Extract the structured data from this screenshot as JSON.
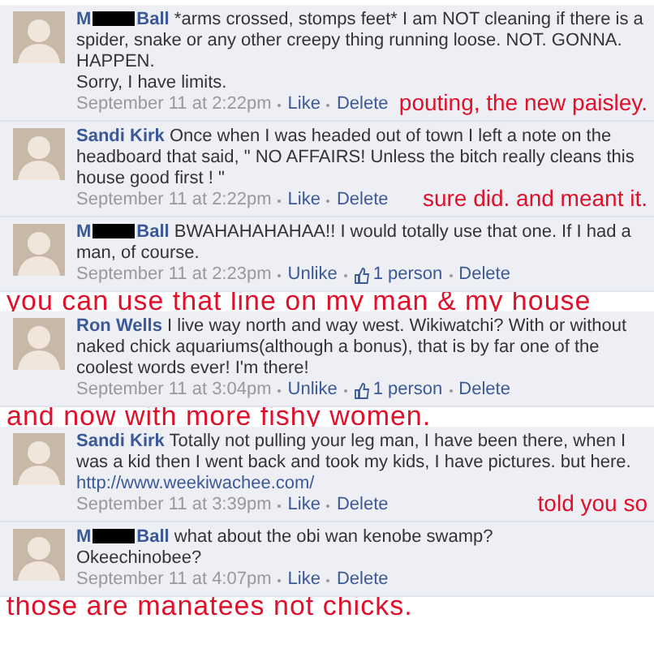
{
  "comments": [
    {
      "author": {
        "name_start": "M",
        "name_end": "Ball",
        "redacted": true
      },
      "text": "*arms crossed, stomps feet* I am NOT cleaning if there is a spider, snake or any other creepy thing running loose. NOT. GONNA. HAPPEN.\nSorry, I have limits.",
      "time": "September 11 at 2:22pm",
      "actions": [
        {
          "kind": "action",
          "label": "Like"
        },
        {
          "kind": "action",
          "label": "Delete"
        }
      ],
      "note": {
        "text": "pouting, the new paisley.",
        "kind": "meta"
      }
    },
    {
      "author": {
        "name_start": "Sandi Kirk",
        "redacted": false
      },
      "text": "Once when I was headed out of town I left a note on the headboard that said, \" NO AFFAIRS! Unless the bitch really cleans this house good first ! \"",
      "time": "September 11 at 2:22pm",
      "actions": [
        {
          "kind": "action",
          "label": "Like"
        },
        {
          "kind": "action",
          "label": "Delete"
        }
      ],
      "note": {
        "text": "sure did. and meant it.",
        "kind": "meta"
      }
    },
    {
      "author": {
        "name_start": "M",
        "name_end": "Ball",
        "redacted": true
      },
      "text": "BWAHAHAHAHAA!! I would totally use that one. If I had a man, of course.",
      "time": "September 11 at 2:23pm",
      "actions": [
        {
          "kind": "action",
          "label": "Unlike"
        },
        {
          "kind": "likes",
          "label": "1 person"
        },
        {
          "kind": "action",
          "label": "Delete"
        }
      ],
      "note": {
        "text": "you can use that line on my man & my house",
        "kind": "band"
      }
    },
    {
      "author": {
        "name_start": "Ron Wells",
        "redacted": false
      },
      "text": "I live way north and way west. Wikiwatchi? With or without naked chick aquariums(although a bonus), that is by far one of the coolest words ever! I'm there!",
      "time": "September 11 at 3:04pm",
      "actions": [
        {
          "kind": "action",
          "label": "Unlike"
        },
        {
          "kind": "likes",
          "label": "1 person"
        },
        {
          "kind": "action",
          "label": "Delete"
        }
      ],
      "note": {
        "text": "and now with more fishy women.",
        "kind": "band"
      }
    },
    {
      "author": {
        "name_start": "Sandi Kirk",
        "redacted": false
      },
      "text": "Totally not pulling your leg man, I have been there, when I was a kid then I went back and took my kids, I have pictures. but here.",
      "link": "http://www.weekiwachee.com/",
      "time": "September 11 at 3:39pm",
      "actions": [
        {
          "kind": "action",
          "label": "Like"
        },
        {
          "kind": "action",
          "label": "Delete"
        }
      ],
      "note": {
        "text": "told you so",
        "kind": "meta"
      }
    },
    {
      "author": {
        "name_start": "M",
        "name_end": "Ball",
        "redacted": true
      },
      "text": "what about the obi wan kenobe swamp?\nOkeechinobee?",
      "time": "September 11 at 4:07pm",
      "actions": [
        {
          "kind": "action",
          "label": "Like"
        },
        {
          "kind": "action",
          "label": "Delete"
        }
      ],
      "note": {
        "text": "those are manatees not chicks.",
        "kind": "band"
      }
    }
  ]
}
